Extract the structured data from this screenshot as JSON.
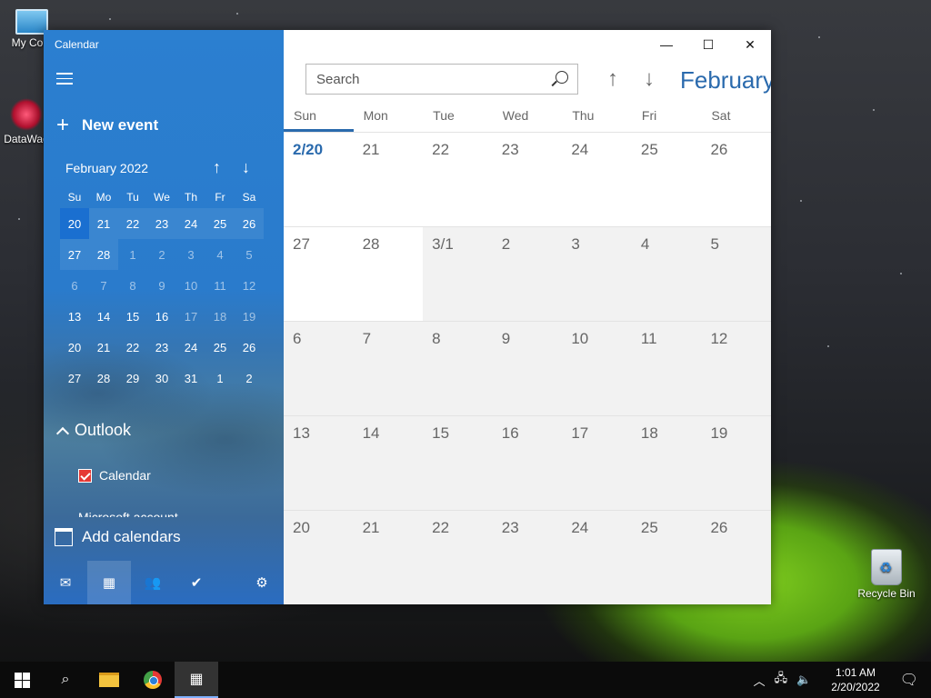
{
  "desktop": {
    "icons": [
      {
        "label": "My Com"
      },
      {
        "label": "DataWag"
      },
      {
        "label": "Recycle Bin"
      }
    ]
  },
  "app": {
    "title": "Calendar",
    "new_event": "New event",
    "add_calendars": "Add calendars",
    "mini_calendar": {
      "month": "February 2022",
      "dow": [
        "Su",
        "Mo",
        "Tu",
        "We",
        "Th",
        "Fr",
        "Sa"
      ],
      "weeks": [
        [
          "20",
          "21",
          "22",
          "23",
          "24",
          "25",
          "26"
        ],
        [
          "27",
          "28",
          "1",
          "2",
          "3",
          "4",
          "5"
        ],
        [
          "6",
          "7",
          "8",
          "9",
          "10",
          "11",
          "12"
        ],
        [
          "13",
          "14",
          "15",
          "16",
          "17",
          "18",
          "19"
        ],
        [
          "20",
          "21",
          "22",
          "23",
          "24",
          "25",
          "26"
        ],
        [
          "27",
          "28",
          "29",
          "30",
          "31",
          "1",
          "2"
        ]
      ]
    },
    "accounts": {
      "outlook": "Outlook",
      "calendar": "Calendar",
      "cut_off": "Microsoft account"
    },
    "search_placeholder": "Search",
    "month_title": "February",
    "week_headers": [
      "Sun",
      "Mon",
      "Tue",
      "Wed",
      "Thu",
      "Fri",
      "Sat"
    ],
    "weeks": [
      [
        "2/20",
        "21",
        "22",
        "23",
        "24",
        "25",
        "26"
      ],
      [
        "27",
        "28",
        "3/1",
        "2",
        "3",
        "4",
        "5"
      ],
      [
        "6",
        "7",
        "8",
        "9",
        "10",
        "11",
        "12"
      ],
      [
        "13",
        "14",
        "15",
        "16",
        "17",
        "18",
        "19"
      ],
      [
        "20",
        "21",
        "22",
        "23",
        "24",
        "25",
        "26"
      ]
    ]
  },
  "taskbar": {
    "time": "1:01 AM",
    "date": "2/20/2022"
  }
}
